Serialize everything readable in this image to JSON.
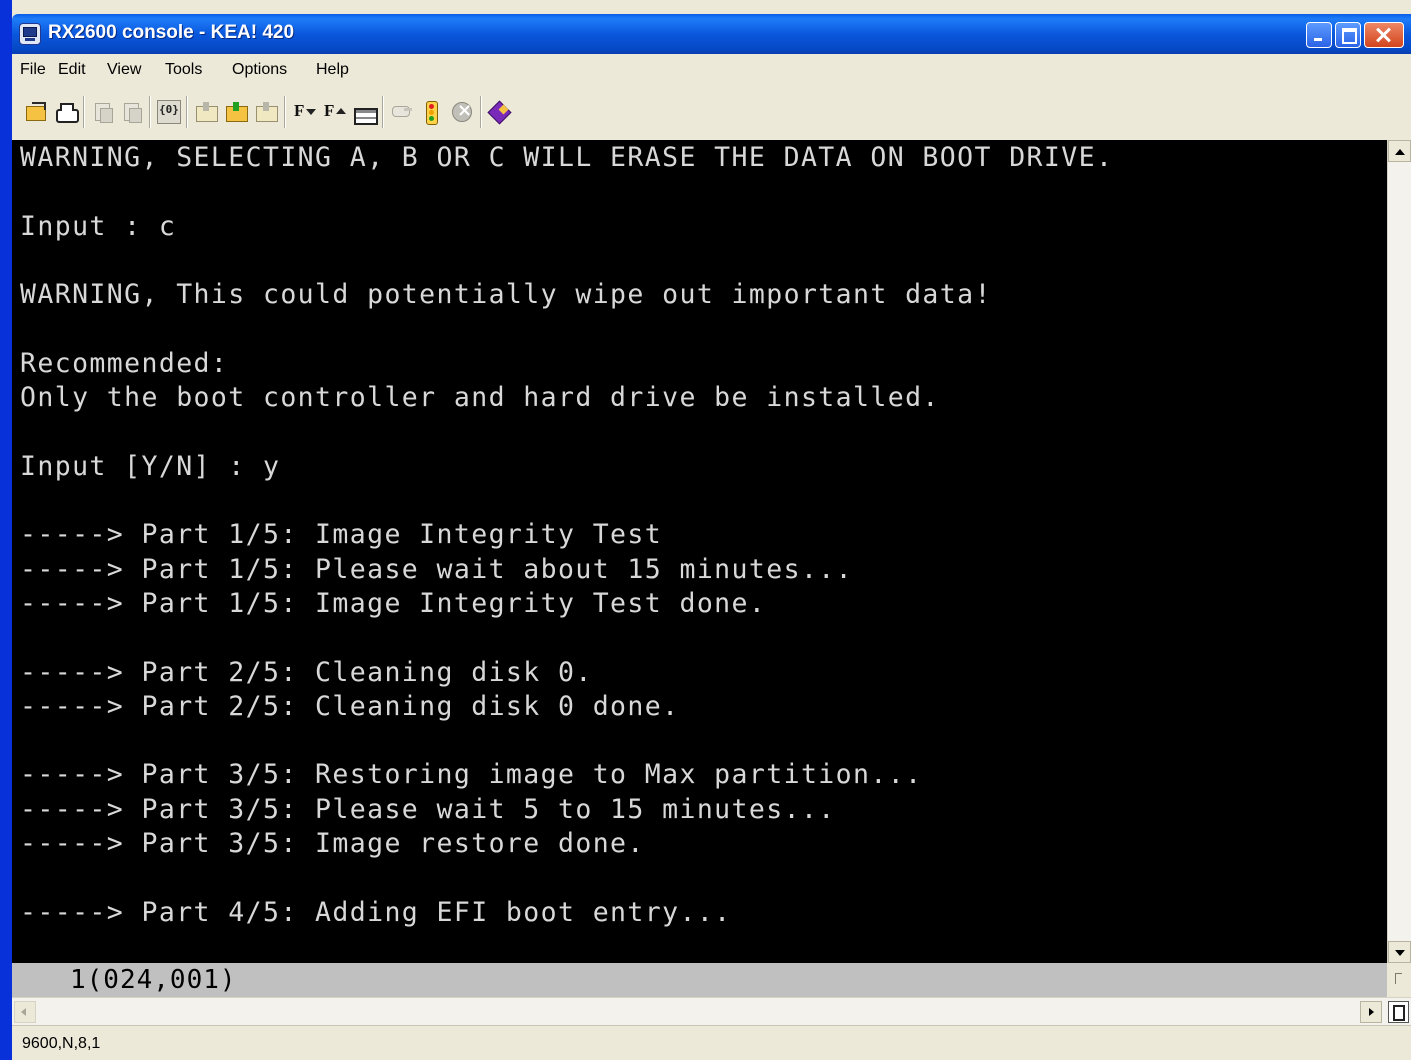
{
  "window": {
    "title": "RX2600 console - KEA! 420"
  },
  "menu": [
    "File",
    "Edit",
    "View",
    "Tools",
    "Options",
    "Help"
  ],
  "toolbar": {
    "icons": [
      "open-icon",
      "print-icon",
      "copy-icon",
      "paste-icon",
      "monitor-icon",
      "folder-icon",
      "upload-folder-icon",
      "folder-icon",
      "font-down-icon",
      "font-up-icon",
      "keyboard-icon",
      "pointer-icon",
      "signal-icon",
      "stop-icon",
      "book-icon"
    ],
    "font_down_label": "F",
    "font_up_label": "F"
  },
  "terminal": {
    "lines": [
      "WARNING, SELECTING A, B OR C WILL ERASE THE DATA ON BOOT DRIVE.",
      "",
      "Input : c",
      "",
      "WARNING, This could potentially wipe out important data!",
      "",
      "Recommended:",
      "Only the boot controller and hard drive be installed.",
      "",
      "Input [Y/N] : y",
      "",
      "-----> Part 1/5: Image Integrity Test",
      "-----> Part 1/5: Please wait about 15 minutes...",
      "-----> Part 1/5: Image Integrity Test done.",
      "",
      "-----> Part 2/5: Cleaning disk 0.",
      "-----> Part 2/5: Cleaning disk 0 done.",
      "",
      "-----> Part 3/5: Restoring image to Max partition...",
      "-----> Part 3/5: Please wait 5 to 15 minutes...",
      "-----> Part 3/5: Image restore done.",
      "",
      "-----> Part 4/5: Adding EFI boot entry..."
    ]
  },
  "cursor_position": "1(024,001)",
  "status": "9600,N,8,1",
  "colors": {
    "terminal_bg": "#000000",
    "terminal_fg": "#d8d8d8",
    "titlebar": "#0a58dd",
    "chrome": "#ece9d8"
  }
}
